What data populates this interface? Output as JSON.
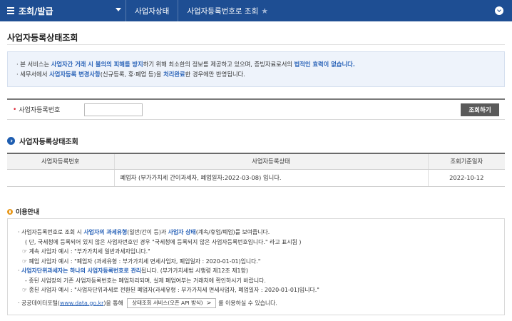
{
  "nav": {
    "menu_title": "조회/발급",
    "crumbs": [
      "사업자상태",
      "사업자등록번호로 조회"
    ]
  },
  "page_title": "사업자등록상태조회",
  "notice": {
    "line1": {
      "a": "본 서비스는 ",
      "b": "사업자간 거래 시 불의의 피해를 방지",
      "c": "하기 위해 최소한의 정보를 제공하고 있으며, 증빙자료로서의 ",
      "d": "법적인 효력이 없습니다."
    },
    "line2": {
      "a": "세무서에서 ",
      "b": "사업자등록 변경사항",
      "c": "(신규등록, 휴·폐업 등)을 ",
      "d": "처리완료",
      "e": "한 경우에만 반영됩니다."
    }
  },
  "search": {
    "label": "사업자등록번호",
    "value": "",
    "placeholder": "",
    "button_label": "조회하기"
  },
  "result": {
    "title": "사업자등록상태조회",
    "columns": [
      "사업자등록번호",
      "사업자등록상태",
      "조회기준일자"
    ],
    "rows": [
      {
        "bizno": "",
        "status": "폐업자 (부가가치세 간이과세자, 폐업일자:2022-03-08) 입니다.",
        "date": "2022-10-12"
      }
    ]
  },
  "guide": {
    "title": "이용안내",
    "l1": {
      "a": "사업자등록번호로 조회 시 ",
      "b": "사업자의 과세유형",
      "c": "(일반/간이 등)과 ",
      "d": "사업자 상태",
      "e": "(계속/휴업/폐업)를 보여줍니다."
    },
    "l2": "( 단, 국세청에 등록되어 있지 않은 사업자번호인 경우 \"국세청에 등록되지 않은 사업자등록번호입니다.\" 라고 표시됨 )",
    "l3": "계속 사업자 예시 : \"부가가치세 일반과세자입니다.\"",
    "l4": "폐업 사업자 예시 : \"폐업자 (과세유형 : 부가가치세 면세사업자, 폐업일자 : 2020-01-01)입니다.\"",
    "l5": {
      "a": "사업자단위과세자는 하나의 사업자등록번호로 관리",
      "b": "됩니다. (부가가치세법 시행령 제12조 제1항)"
    },
    "l6": "- 종된 사업장의 기존 사업자등록번호는 폐업처리되며, 실제 폐업여부는 거래처에 확인하시기 바랍니다.",
    "l7": "종된 사업자 예시 : \"사업자단위과세로 전환된 폐업자(과세유형 : 부가가치세 면세사업자, 폐업일자 : 2020-01-01)입니다.\"",
    "l8": {
      "a": "공공데이터포털(",
      "link": "www.data.go.kr",
      "b": ")을 통해 ",
      "button": "상태조회 서비스(오픈 API 방식)",
      "c": "를 이용하실 수 있습니다."
    },
    "example_mark": "☞"
  }
}
